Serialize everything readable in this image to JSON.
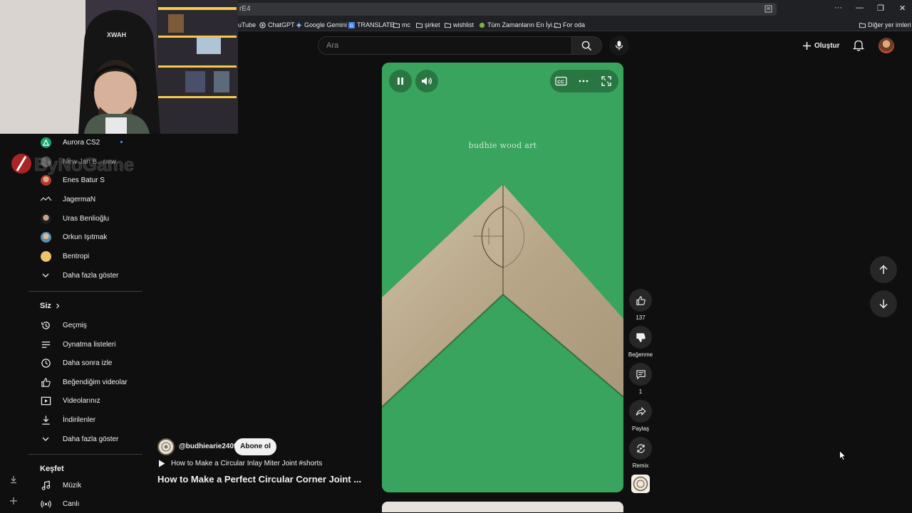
{
  "browser": {
    "address_text": "rE4",
    "window_controls": {
      "more": "···",
      "minimize": "—",
      "restore": "❐",
      "close": "✕"
    },
    "bookmarks": [
      {
        "label": "uTube",
        "icon": "youtube-icon"
      },
      {
        "label": "ChatGPT",
        "icon": "chatgpt-icon"
      },
      {
        "label": "Google Gemini",
        "icon": "gemini-icon"
      },
      {
        "label": "TRANSLATE",
        "icon": "translate-icon"
      },
      {
        "label": "mc",
        "icon": "folder-icon"
      },
      {
        "label": "şirket",
        "icon": "folder-icon"
      },
      {
        "label": "wishlist",
        "icon": "folder-icon"
      },
      {
        "label": "Tüm Zamanların En İyi...",
        "icon": "page-icon"
      },
      {
        "label": "For oda",
        "icon": "folder-icon"
      }
    ],
    "other_bookmarks": "Diğer yer imleri"
  },
  "sidebar": {
    "subscriptions": [
      {
        "name": "Aurora CS2",
        "icon": "aurora-avatar",
        "new": true
      },
      {
        "name": "New Jan B...new",
        "icon": "channel-avatar"
      },
      {
        "name": "Enes Batur S",
        "icon": "channel-avatar"
      },
      {
        "name": "JagermaN",
        "icon": "channel-avatar"
      },
      {
        "name": "Uras Benlioğlu",
        "icon": "channel-avatar"
      },
      {
        "name": "Orkun Işıtmak",
        "icon": "channel-avatar"
      },
      {
        "name": "Bentropi",
        "icon": "channel-avatar"
      }
    ],
    "show_more_1": "Daha fazla göster",
    "you_section": "Siz",
    "you_items": [
      {
        "label": "Geçmiş",
        "icon": "history-icon"
      },
      {
        "label": "Oynatma listeleri",
        "icon": "playlist-icon"
      },
      {
        "label": "Daha sonra izle",
        "icon": "clock-icon"
      },
      {
        "label": "Beğendiğim videolar",
        "icon": "like-icon"
      },
      {
        "label": "Videolarınız",
        "icon": "video-icon"
      },
      {
        "label": "İndirilenler",
        "icon": "download-icon"
      }
    ],
    "show_more_2": "Daha fazla göster",
    "explore_section": "Keşfet",
    "explore_items": [
      {
        "label": "Müzik",
        "icon": "music-icon"
      },
      {
        "label": "Canlı",
        "icon": "live-icon"
      }
    ]
  },
  "header": {
    "search_placeholder": "Ara",
    "create_label": "Oluştur"
  },
  "video": {
    "watermark": "budhie wood art"
  },
  "actions": {
    "like_count": "137",
    "dislike_label": "Beğenme",
    "comment_count": "1",
    "share_label": "Paylaş",
    "remix_label": "Remix"
  },
  "channel": {
    "handle": "@budhiearie2409",
    "subscribe_label": "Abone ol",
    "related_video": "How to Make a Circular Inlay Miter Joint #shorts",
    "short_title": "How to Make a Perfect Circular Corner Joint ..."
  },
  "overlay": {
    "logo_text": "ByNoGame"
  },
  "colors": {
    "background": "#0f0f0f",
    "video_green": "#3cab62",
    "accent_blue": "#3ea6ff"
  }
}
